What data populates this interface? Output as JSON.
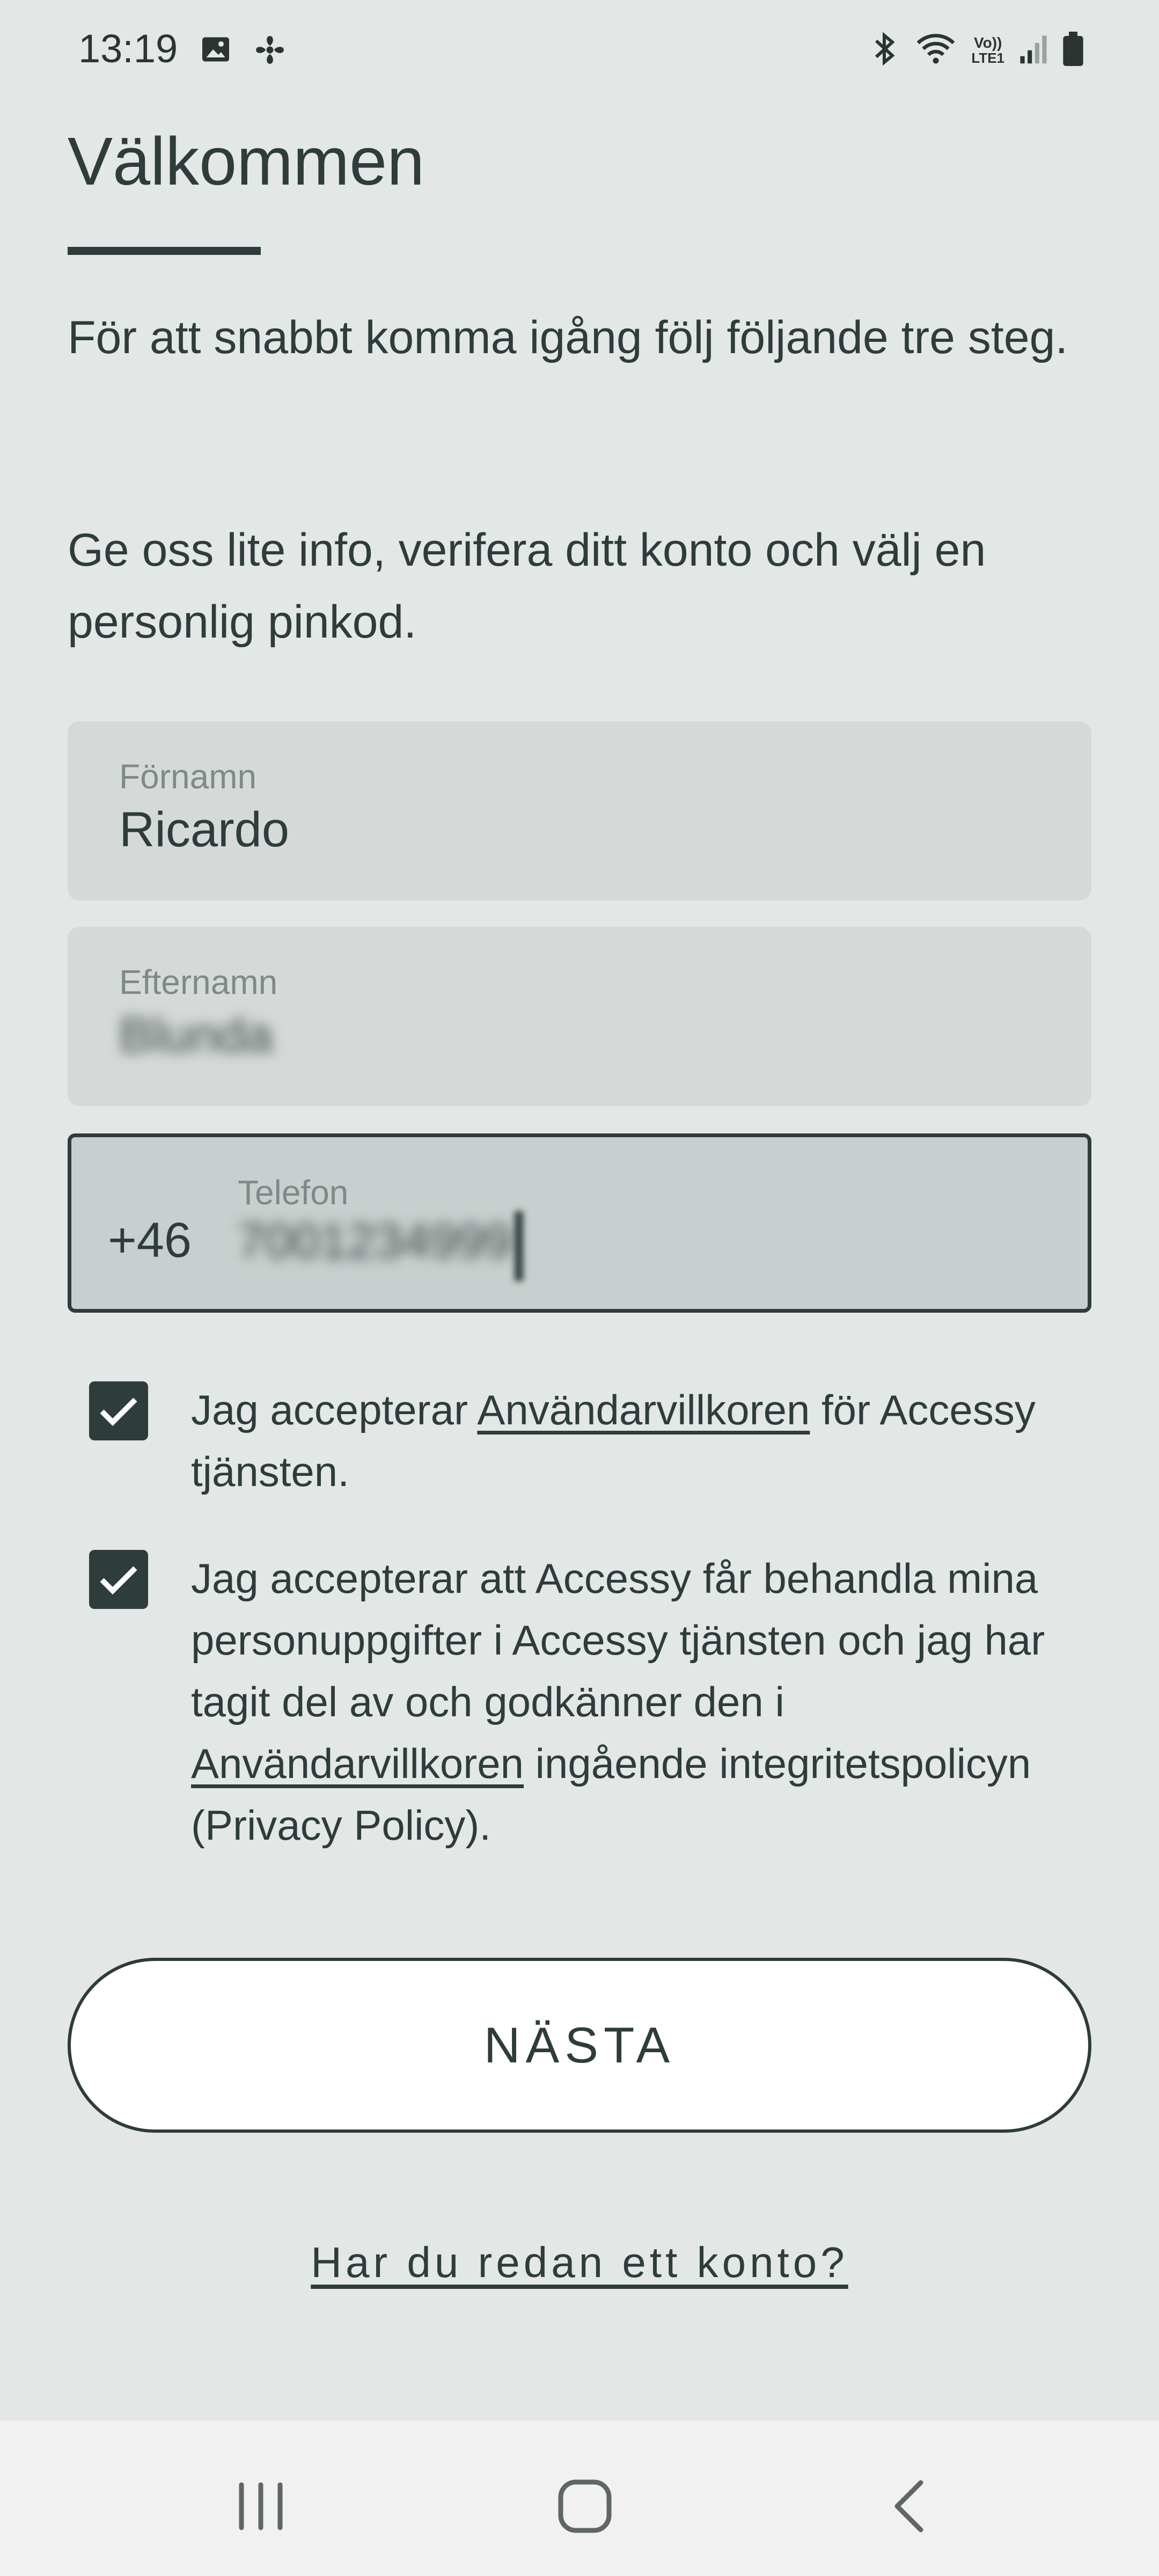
{
  "status_bar": {
    "time": "13:19",
    "left_icons": [
      "image-icon",
      "fan-icon"
    ],
    "right_icons": [
      "bluetooth-icon",
      "wifi-icon",
      "volte-icon",
      "signal-icon",
      "battery-icon"
    ],
    "volte_label": "Vo))",
    "lte_label": "LTE1"
  },
  "header": {
    "title": "Välkommen"
  },
  "intro": {
    "paragraph1": "För att snabbt komma igång följ följande tre steg.",
    "paragraph2": "Ge oss lite info, verifera ditt konto och välj en personlig pinkod."
  },
  "form": {
    "first_name": {
      "label": "Förnamn",
      "value": "Ricardo"
    },
    "last_name": {
      "label": "Efternamn",
      "value": "Blunda"
    },
    "phone": {
      "label": "Telefon",
      "prefix": "+46",
      "value": "7001234999"
    }
  },
  "consents": [
    {
      "checked": true,
      "text_before": "Jag accepterar ",
      "link": "Användarvillkoren",
      "text_after": " för Accessy tjänsten."
    },
    {
      "checked": true,
      "text_before": "Jag accepterar att Accessy får behandla mina personuppgifter i Accessy tjänsten och jag har tagit del av och godkänner den i ",
      "link": "Användarvillkoren",
      "text_after": " ingående integritetspolicyn (Privacy Policy)."
    }
  ],
  "actions": {
    "next_label": "NÄSTA",
    "login_link": "Har du redan ett konto?"
  },
  "nav": {
    "icons": [
      "recents-icon",
      "home-icon",
      "back-icon"
    ]
  },
  "colors": {
    "background": "#e3e7e6",
    "primary": "#2e3c3b",
    "field_bg": "#d5dad9",
    "button_bg": "#ffffff"
  }
}
